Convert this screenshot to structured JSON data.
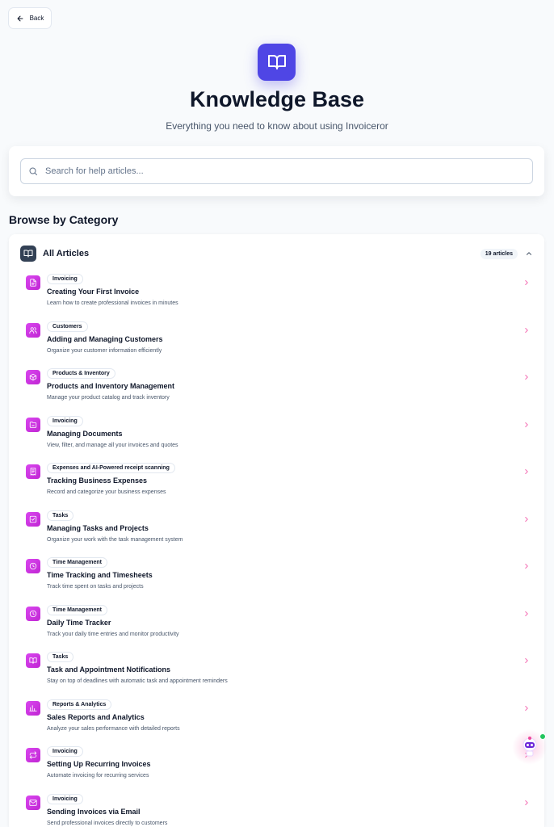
{
  "back_label": "Back",
  "header": {
    "title": "Knowledge Base",
    "subtitle": "Everything you need to know about using Invoiceror"
  },
  "search": {
    "placeholder": "Search for help articles..."
  },
  "browse_heading": "Browse by Category",
  "category": {
    "title": "All Articles",
    "count": "19 articles",
    "articles": [
      {
        "badge": "Invoicing",
        "title": "Creating Your First Invoice",
        "desc": "Learn how to create professional invoices in minutes",
        "icon": "file-text-icon"
      },
      {
        "badge": "Customers",
        "title": "Adding and Managing Customers",
        "desc": "Organize your customer information efficiently",
        "icon": "users-icon"
      },
      {
        "badge": "Products & Inventory",
        "title": "Products and Inventory Management",
        "desc": "Manage your product catalog and track inventory",
        "icon": "package-icon"
      },
      {
        "badge": "Invoicing",
        "title": "Managing Documents",
        "desc": "View, filter, and manage all your invoices and quotes",
        "icon": "folder-icon"
      },
      {
        "badge": "Expenses and AI-Powered receipt scanning",
        "title": "Tracking Business Expenses",
        "desc": "Record and categorize your business expenses",
        "icon": "receipt-icon"
      },
      {
        "badge": "Tasks",
        "title": "Managing Tasks and Projects",
        "desc": "Organize your work with the task management system",
        "icon": "check-square-icon"
      },
      {
        "badge": "Time Management",
        "title": "Time Tracking and Timesheets",
        "desc": "Track time spent on tasks and projects",
        "icon": "clock-icon"
      },
      {
        "badge": "Time Management",
        "title": "Daily Time Tracker",
        "desc": "Track your daily time entries and monitor productivity",
        "icon": "clock-icon"
      },
      {
        "badge": "Tasks",
        "title": "Task and Appointment Notifications",
        "desc": "Stay on top of deadlines with automatic task and appointment reminders",
        "icon": "book-icon"
      },
      {
        "badge": "Reports & Analytics",
        "title": "Sales Reports and Analytics",
        "desc": "Analyze your sales performance with detailed reports",
        "icon": "bar-chart-icon"
      },
      {
        "badge": "Invoicing",
        "title": "Setting Up Recurring Invoices",
        "desc": "Automate invoicing for recurring services",
        "icon": "repeat-icon"
      },
      {
        "badge": "Invoicing",
        "title": "Sending Invoices via Email",
        "desc": "Send professional invoices directly to customers",
        "icon": "mail-icon"
      }
    ]
  },
  "colors": {
    "accent": "#4f46e5",
    "article_icon": "#d946ef",
    "chevron": "#f472b6",
    "online": "#22c55e"
  }
}
